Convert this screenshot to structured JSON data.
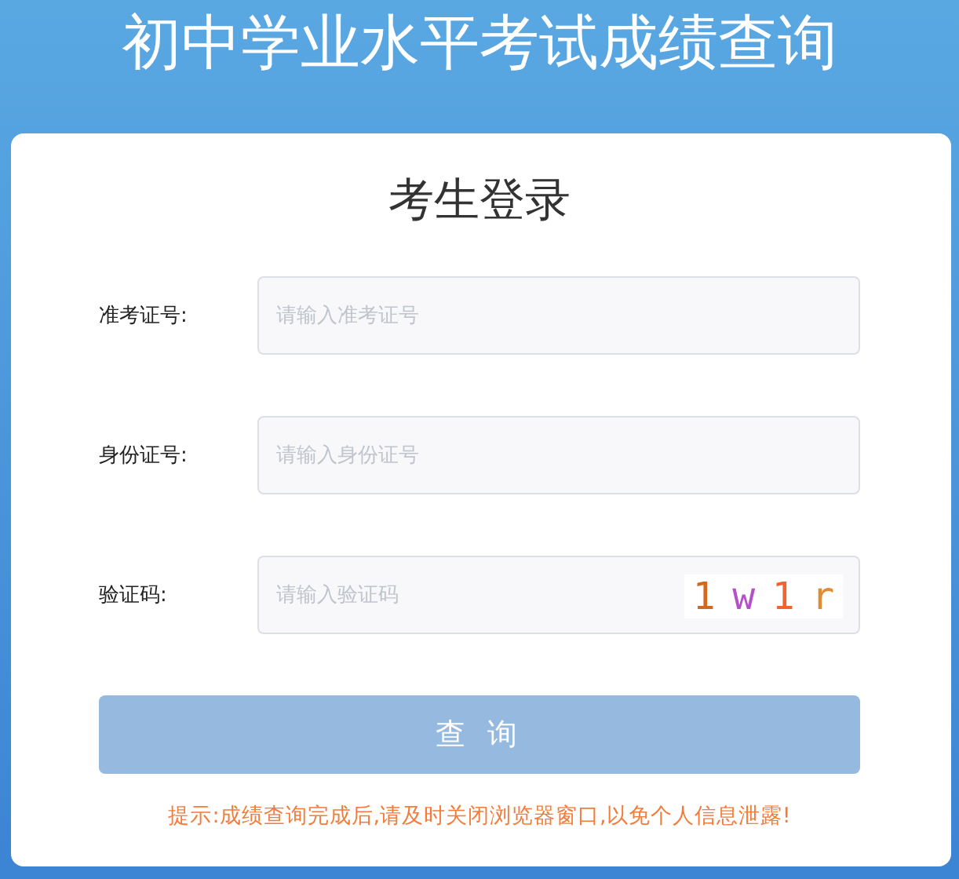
{
  "header": {
    "title": "初中学业水平考试成绩查询"
  },
  "card": {
    "title": "考生登录"
  },
  "fields": [
    {
      "label": "准考证号:",
      "placeholder": "请输入准考证号",
      "kind": "text"
    },
    {
      "label": "身份证号:",
      "placeholder": "请输入身份证号",
      "kind": "text"
    },
    {
      "label": "验证码:",
      "placeholder": "请输入验证码",
      "kind": "captcha",
      "captcha": [
        {
          "char": "1",
          "color": "#d2691e"
        },
        {
          "char": "w",
          "color": "#b450c8"
        },
        {
          "char": "1",
          "color": "#f06432"
        },
        {
          "char": "r",
          "color": "#e08c32"
        }
      ]
    }
  ],
  "button": {
    "label": "查 询",
    "disabled": true
  },
  "hint": "提示:成绩查询完成后,请及时关闭浏览器窗口,以免个人信息泄露!"
}
